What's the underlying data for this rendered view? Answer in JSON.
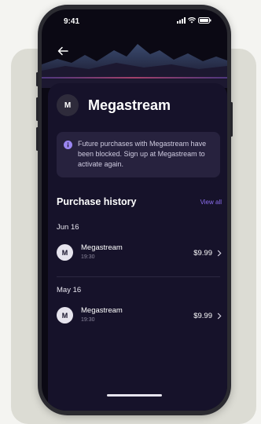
{
  "status_bar": {
    "time": "9:41"
  },
  "header": {
    "avatar_initial": "M",
    "title": "Megastream"
  },
  "notice": {
    "text": "Future purchases with Megastream have been blocked. Sign up at Megastream to activate again."
  },
  "purchase_history": {
    "title": "Purchase history",
    "view_all": "View all",
    "groups": [
      {
        "date": "Jun 16",
        "item": {
          "avatar_initial": "M",
          "name": "Megastream",
          "time": "19:30",
          "price": "$9.99"
        }
      },
      {
        "date": "May 16",
        "item": {
          "avatar_initial": "M",
          "name": "Megastream",
          "time": "19:30",
          "price": "$9.99"
        }
      }
    ]
  },
  "colors": {
    "screen_bg": "#0b0914",
    "panel_bg": "#16122a",
    "notice_bg": "#27223e",
    "accent": "#8d6ff0"
  }
}
